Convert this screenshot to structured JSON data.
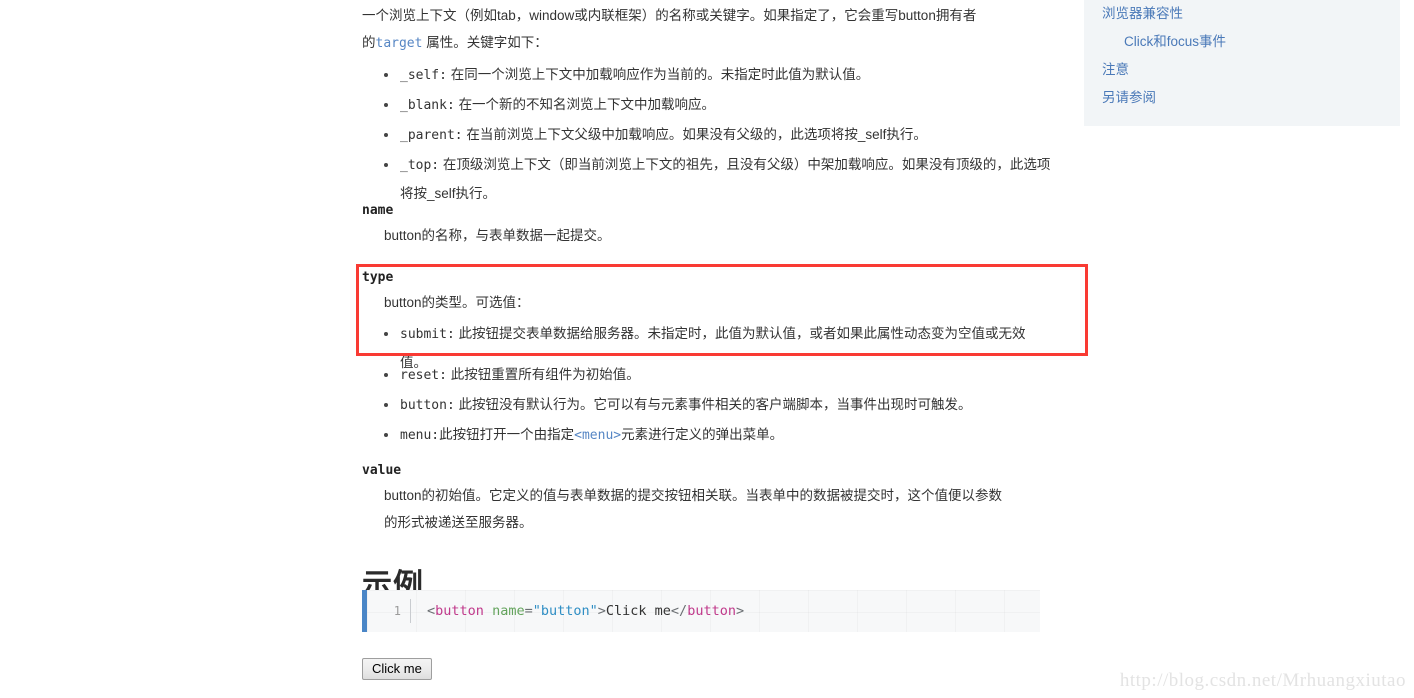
{
  "sidebar": {
    "items": [
      {
        "label": "浏览器兼容性",
        "level": 1
      },
      {
        "label": "Click和focus事件",
        "level": 2
      },
      {
        "label": "注意",
        "level": 1
      },
      {
        "label": "另请参阅",
        "level": 1
      }
    ],
    "background_color": "#f2f5f7",
    "link_color": "#4a79b8"
  },
  "content": {
    "target": {
      "para_line1": "一个浏览上下文（例如tab，window或内联框架）的名称或关键字。如果指定了，它会重写button拥有者",
      "para_line2_prefix": "的",
      "para_link": "target",
      "para_line2_suffix": "属性。关键字如下：",
      "keywords": [
        {
          "code": "_self:",
          "text": "在同一个浏览上下文中加载响应作为当前的。未指定时此值为默认值。"
        },
        {
          "code": "_blank:",
          "text": "在一个新的不知名浏览上下文中加载响应。"
        },
        {
          "code": "_parent:",
          "text": "在当前浏览上下文父级中加载响应。如果没有父级的，此选项将按_self执行。"
        },
        {
          "code": "_top:",
          "text": "在顶级浏览上下文（即当前浏览上下文的祖先，且没有父级）中架加载响应。如果没有顶级的，此选项将按_self执行。"
        }
      ]
    },
    "name": {
      "term": "name",
      "description": "button的名称，与表单数据一起提交。"
    },
    "type": {
      "term": "type",
      "description": "button的类型。可选值：",
      "options": [
        {
          "code": "submit:",
          "text": "此按钮提交表单数据给服务器。未指定时，此值为默认值，或者如果此属性动态变为空值或无效值。"
        },
        {
          "code": "reset:",
          "text": "此按钮重置所有组件为初始值。"
        },
        {
          "code": "button:",
          "text": "此按钮没有默认行为。它可以有与元素事件相关的客户端脚本，当事件出现时可触发。"
        },
        {
          "code": "menu:",
          "text_before": "此按钮打开一个由指定",
          "link": "<menu>",
          "text_after": "元素进行定义的弹出菜单。"
        }
      ]
    },
    "value": {
      "term": "value",
      "description_line1": "button的初始值。它定义的值与表单数据的提交按钮相关联。当表单中的数据被提交时，这个值便以参数",
      "description_line2": "的形式被递送至服务器。"
    },
    "example_heading": "示例",
    "code": {
      "line_number": "1",
      "tokens": [
        {
          "type": "punct",
          "text": "<"
        },
        {
          "type": "tag",
          "text": "button"
        },
        {
          "type": "plain",
          "text": " "
        },
        {
          "type": "attr",
          "text": "name"
        },
        {
          "type": "eq",
          "text": "="
        },
        {
          "type": "string",
          "text": "\"button\""
        },
        {
          "type": "punct",
          "text": ">"
        },
        {
          "type": "plain",
          "text": "Click me"
        },
        {
          "type": "punct",
          "text": "</"
        },
        {
          "type": "tag",
          "text": "button"
        },
        {
          "type": "punct",
          "text": ">"
        }
      ],
      "plain_text": "<button name=\"button\">Click me</button>"
    },
    "demo_button_label": "Click me"
  },
  "watermark": "http://blog.csdn.net/Mrhuangxiutao",
  "annotation": {
    "highlight_color": "#f93a33"
  }
}
